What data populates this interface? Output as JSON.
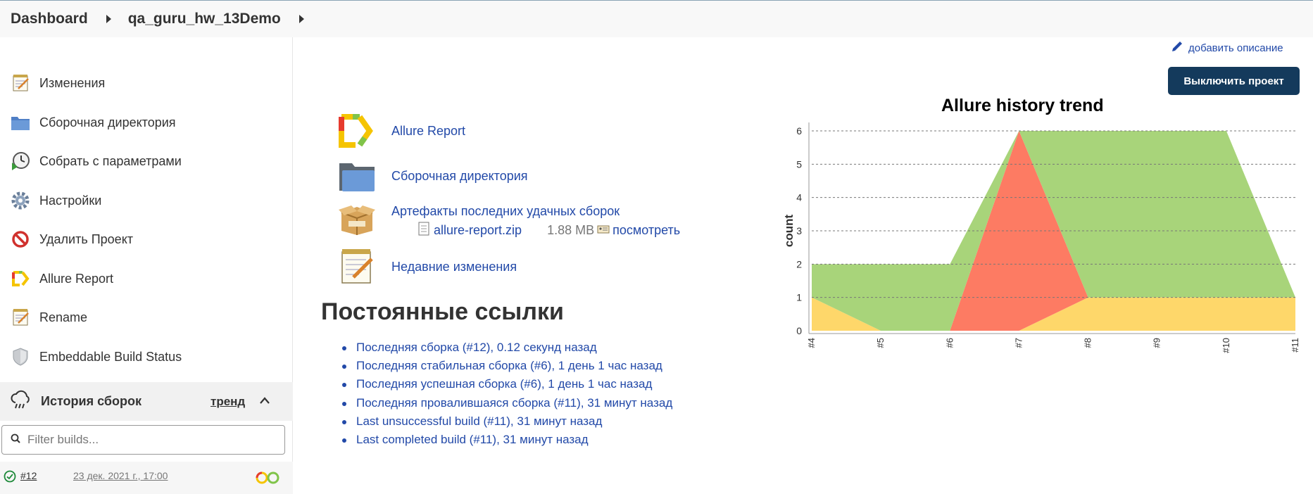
{
  "breadcrumb": {
    "dashboard": "Dashboard",
    "project": "qa_guru_hw_13Demo"
  },
  "sidebar": {
    "items": [
      {
        "label": "Изменения",
        "icon": "notepad-icon"
      },
      {
        "label": "Сборочная директория",
        "icon": "folder-icon"
      },
      {
        "label": "Собрать с параметрами",
        "icon": "clock-play-icon"
      },
      {
        "label": "Настройки",
        "icon": "gear-icon"
      },
      {
        "label": "Удалить Проект",
        "icon": "no-entry-icon"
      },
      {
        "label": "Allure Report",
        "icon": "allure-icon"
      },
      {
        "label": "Rename",
        "icon": "notepad-icon"
      },
      {
        "label": "Embeddable Build Status",
        "icon": "shield-icon"
      }
    ],
    "build_history": {
      "title": "История сборок",
      "trend": "тренд",
      "filter_placeholder": "Filter builds...",
      "builds": [
        {
          "number": "#12",
          "date": "23 дек. 2021 г., 17:00",
          "status": "success"
        }
      ]
    }
  },
  "main": {
    "add_description": "добавить описание",
    "disable_button": "Выключить проект",
    "links": {
      "allure": "Allure Report",
      "workspace": "Сборочная директория",
      "artifacts": "Артефакты последних удачных сборок",
      "artifact_file": "allure-report.zip",
      "artifact_size": "1.88 MB",
      "artifact_view": "посмотреть",
      "changes": "Недавние изменения"
    },
    "permalinks_title": "Постоянные ссылки",
    "permalinks": [
      "Последняя сборка (#12), 0.12 секунд назад",
      "Последняя стабильная сборка (#6), 1 день 1 час назад",
      "Последняя успешная сборка (#6), 1 день 1 час назад",
      "Последняя провалившаяся сборка (#11), 31 минут назад",
      "Last unsuccessful build (#11), 31 минут назад",
      "Last completed build (#11), 31 минут назад"
    ]
  },
  "colors": {
    "passed": "#a8d47a",
    "failed": "#fd7b63",
    "broken": "#fed76a",
    "button": "#143a5c",
    "link": "#2249a8"
  },
  "chart_data": {
    "type": "area",
    "title": "Allure history trend",
    "ylabel": "count",
    "xlabel": "",
    "categories": [
      "#4",
      "#5",
      "#6",
      "#7",
      "#8",
      "#9",
      "#10",
      "#11"
    ],
    "series": [
      {
        "name": "",
        "color": "#fed76a",
        "values": [
          1,
          0,
          0,
          0,
          1,
          1,
          1,
          1
        ]
      },
      {
        "name": "",
        "color": "#fd7b63",
        "values": [
          0,
          0,
          0,
          6,
          0,
          0,
          0,
          0
        ]
      },
      {
        "name": "",
        "color": "#a8d47a",
        "values": [
          1,
          2,
          2,
          0,
          5,
          5,
          5,
          0
        ]
      }
    ],
    "ylim": [
      0,
      6
    ],
    "yticks": [
      "0",
      "1",
      "2",
      "3",
      "4",
      "5",
      "6"
    ],
    "grid": true
  }
}
